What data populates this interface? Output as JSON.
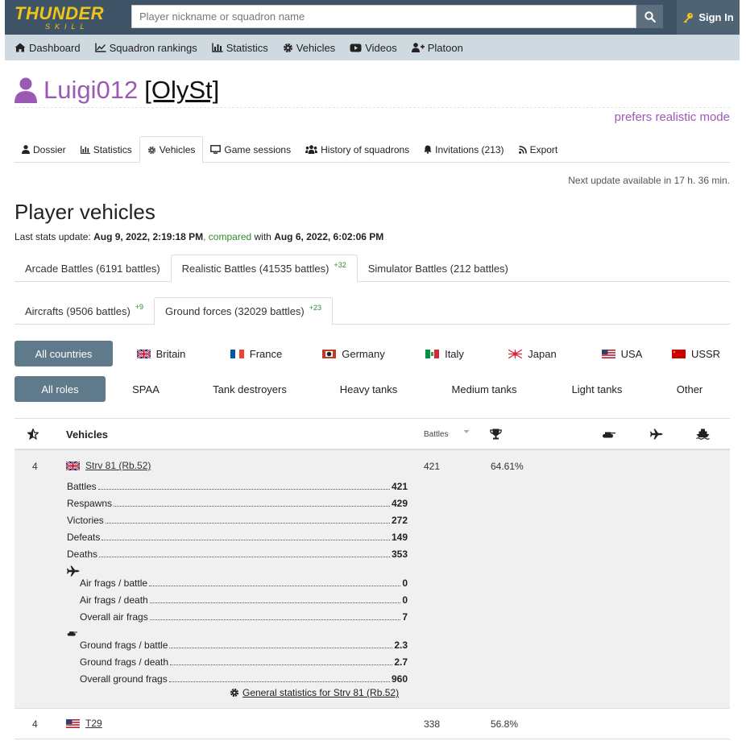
{
  "header": {
    "logo_top": "THUNDER",
    "logo_bottom": "SKILL",
    "search_placeholder": "Player nickname or squadron name",
    "sign_in": "Sign In"
  },
  "nav": {
    "items": [
      {
        "label": "Dashboard",
        "icon": "home-icon"
      },
      {
        "label": "Squadron rankings",
        "icon": "line-chart-icon"
      },
      {
        "label": "Statistics",
        "icon": "bar-chart-icon"
      },
      {
        "label": "Vehicles",
        "icon": "gear-icon"
      },
      {
        "label": "Videos",
        "icon": "youtube-icon"
      },
      {
        "label": "Platoon",
        "icon": "user-plus-icon"
      }
    ]
  },
  "profile": {
    "name": "Luigi012",
    "squadron": "[OlySt]",
    "prefers": "prefers realistic mode"
  },
  "profile_tabs": [
    {
      "label": "Dossier"
    },
    {
      "label": "Statistics"
    },
    {
      "label": "Vehicles"
    },
    {
      "label": "Game sessions"
    },
    {
      "label": "History of squadrons"
    },
    {
      "label": "Invitations (213)"
    },
    {
      "label": "Export"
    }
  ],
  "next_update": "Next update available in 17 h. 36 min.",
  "page_title": "Player vehicles",
  "last_stats": {
    "prefix": "Last stats update:",
    "date1": "Aug 9, 2022, 2:19:18 PM",
    "compared": ", compared",
    "with": " with ",
    "date2": "Aug 6, 2022, 6:02:06 PM"
  },
  "mode_tabs": [
    {
      "label": "Arcade Battles (6191 battles)",
      "delta": ""
    },
    {
      "label": "Realistic Battles (41535 battles)",
      "delta": "+32"
    },
    {
      "label": "Simulator Battles (212 battles)",
      "delta": ""
    }
  ],
  "type_tabs": [
    {
      "label": "Aircrafts (9506 battles)",
      "delta": "+9"
    },
    {
      "label": "Ground forces (32029 battles)",
      "delta": "+23"
    }
  ],
  "countries": [
    "All countries",
    "Britain",
    "France",
    "Germany",
    "Italy",
    "Japan",
    "USA",
    "USSR"
  ],
  "roles": [
    "All roles",
    "SPAA",
    "Tank destroyers",
    "Heavy tanks",
    "Medium tanks",
    "Light tanks",
    "Other"
  ],
  "table": {
    "col_vehicles": "Vehicles",
    "col_battles": "Battles",
    "rows": [
      {
        "rank": "4",
        "name": "Strv 81 (Rb.52)",
        "battles": "421",
        "winrate": "64.61%",
        "stats": [
          {
            "label": "Battles",
            "value": "421"
          },
          {
            "label": "Respawns",
            "value": "429"
          },
          {
            "label": "Victories",
            "value": "272"
          },
          {
            "label": "Defeats",
            "value": "149"
          },
          {
            "label": "Deaths",
            "value": "353"
          }
        ],
        "air_stats": [
          {
            "label": "Air frags / battle",
            "value": "0"
          },
          {
            "label": "Air frags / death",
            "value": "0"
          },
          {
            "label": "Overall air frags",
            "value": "7"
          }
        ],
        "ground_stats": [
          {
            "label": "Ground frags / battle",
            "value": "2.3"
          },
          {
            "label": "Ground frags / death",
            "value": "2.7"
          },
          {
            "label": "Overall ground frags",
            "value": "960"
          }
        ],
        "general_link": "General statistics for Strv 81 (Rb.52)"
      },
      {
        "rank": "4",
        "name": "T29",
        "battles": "338",
        "winrate": "56.8%"
      }
    ]
  },
  "colors": {
    "topbar": "#3f5567",
    "navbar": "#ced9e0",
    "accent_purple": "#9b59b6",
    "logo_yellow": "#f0c419",
    "active_filter": "#5f7a8a",
    "delta_green": "#2e8b2e"
  }
}
